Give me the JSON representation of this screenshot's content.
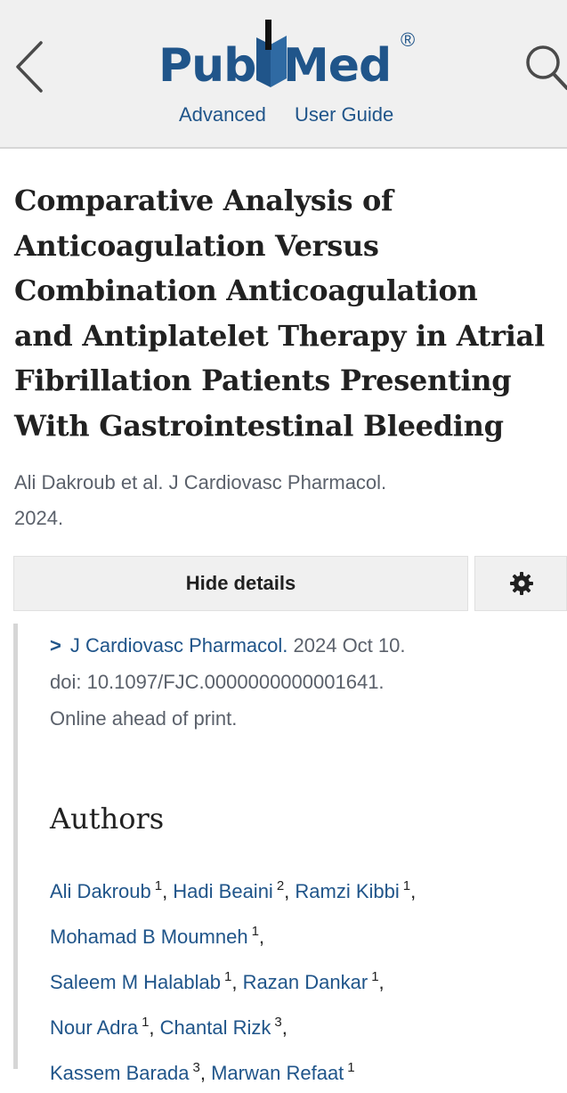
{
  "header": {
    "logo_pub": "Pub",
    "logo_med": "Med",
    "logo_reg": "®",
    "link_advanced": "Advanced",
    "link_user_guide": "User Guide",
    "back_icon": "chevron-left-icon",
    "search_icon": "search-icon"
  },
  "article": {
    "title_lines": [
      "Comparative Analysis of",
      "Anticoagulation Versus",
      "Combination Anticoagulation",
      "and Antiplatelet Therapy in Atrial",
      "Fibrillation Patients Presenting",
      "With Gastrointestinal Bleeding"
    ],
    "citation_line1": "Ali Dakroub et al. J Cardiovasc Pharmacol.",
    "citation_line2": "2024."
  },
  "actions": {
    "hide_details_label": "Hide details",
    "settings_icon": "gear-icon"
  },
  "details": {
    "journal": "J Cardiovasc Pharmacol.",
    "date": " 2024 Oct 10.",
    "doi": "doi: 10.1097/FJC.0000000000001641.",
    "status": "Online ahead of print.",
    "authors_heading": "Authors"
  },
  "authors": [
    {
      "name": "Ali Dakroub",
      "aff": "1"
    },
    {
      "name": "Hadi Beaini",
      "aff": "2"
    },
    {
      "name": "Ramzi Kibbi",
      "aff": "1"
    },
    {
      "name": "Mohamad B Moumneh",
      "aff": "1"
    },
    {
      "name": "Saleem M Halablab",
      "aff": "1"
    },
    {
      "name": "Razan Dankar",
      "aff": "1"
    },
    {
      "name": "Nour Adra",
      "aff": "1"
    },
    {
      "name": "Chantal Rizk",
      "aff": "3"
    },
    {
      "name": "Kassem Barada",
      "aff": "3"
    },
    {
      "name": "Marwan Refaat",
      "aff": "1"
    }
  ],
  "colors": {
    "link": "#20558a",
    "header_bg": "#f0f0f0",
    "muted_text": "#5b616b"
  }
}
